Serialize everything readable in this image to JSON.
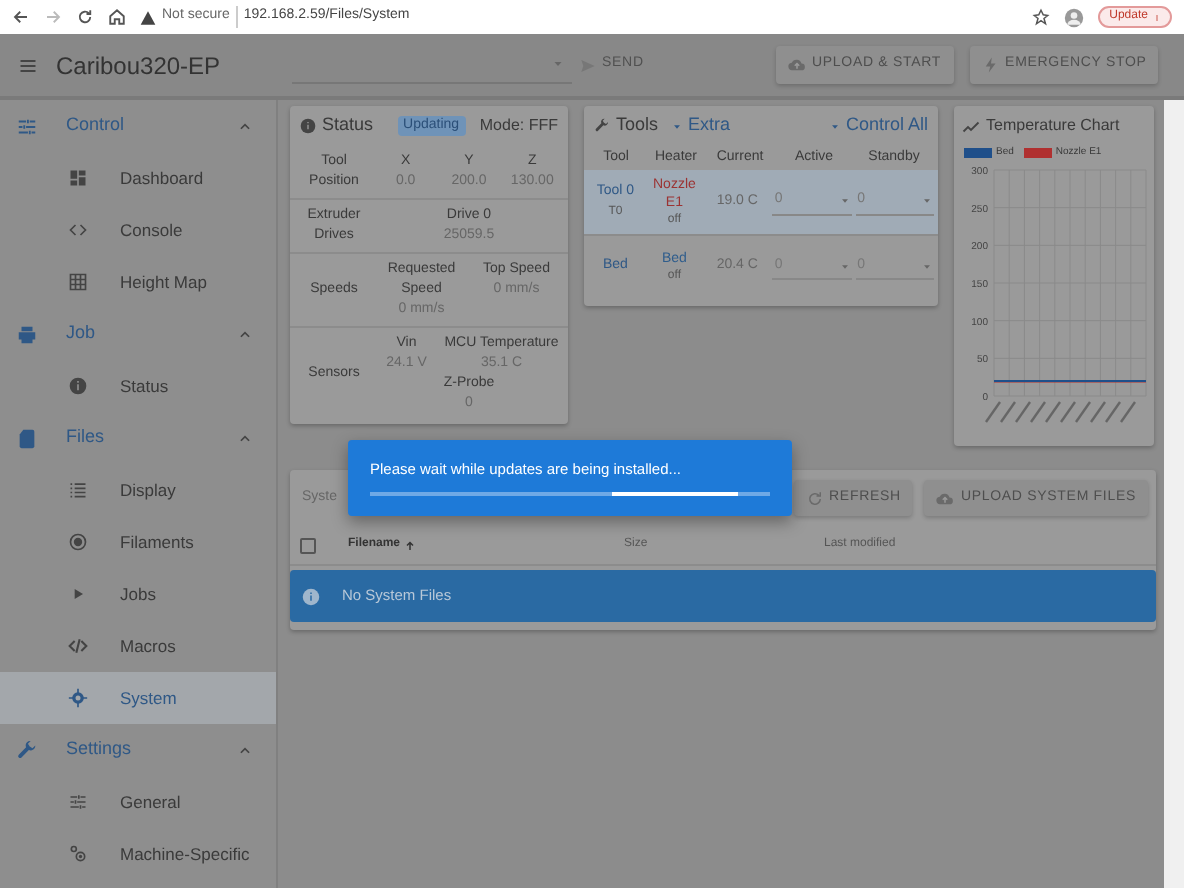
{
  "browser": {
    "security": "Not secure",
    "url": "192.168.2.59/Files/System",
    "update_button": "Update"
  },
  "app_bar": {
    "title": "Caribou320-EP",
    "send_button": "SEND",
    "buttons": [
      {
        "label": "UPLOAD & START"
      },
      {
        "label": "EMERGENCY STOP"
      }
    ]
  },
  "sidebar": {
    "groups": [
      {
        "label": "Control",
        "expanded": true,
        "items": [
          {
            "label": "Dashboard",
            "selected": false
          },
          {
            "label": "Console",
            "selected": false
          },
          {
            "label": "Height Map",
            "selected": false
          }
        ]
      },
      {
        "label": "Job",
        "expanded": true,
        "items": [
          {
            "label": "Status",
            "selected": false
          }
        ]
      },
      {
        "label": "Files",
        "expanded": true,
        "items": [
          {
            "label": "Display",
            "selected": false
          },
          {
            "label": "Filaments",
            "selected": false
          },
          {
            "label": "Jobs",
            "selected": false
          },
          {
            "label": "Macros",
            "selected": false
          },
          {
            "label": "System",
            "selected": true
          }
        ]
      },
      {
        "label": "Settings",
        "expanded": true,
        "items": [
          {
            "label": "General",
            "selected": false
          },
          {
            "label": "Machine-Specific",
            "selected": false
          }
        ]
      }
    ]
  },
  "status": {
    "title": "Status",
    "badge": "Updating",
    "mode": "Mode: FFF",
    "sections": [
      {
        "label": "Tool Position",
        "readings": [
          {
            "head": "X",
            "value": "0.0"
          },
          {
            "head": "Y",
            "value": "200.0"
          },
          {
            "head": "Z",
            "value": "130.00"
          }
        ]
      },
      {
        "label": "Extruder Drives",
        "readings": [
          {
            "head": "Drive 0",
            "value": "25059.5"
          }
        ]
      },
      {
        "label": "Speeds",
        "readings": [
          {
            "head": "Requested Speed",
            "value": "0 mm/s"
          },
          {
            "head": "Top Speed",
            "value": "0 mm/s"
          }
        ]
      },
      {
        "label": "Sensors",
        "readings": [
          {
            "head": "Vin",
            "value": "24.1 V"
          },
          {
            "head": "MCU Temperature",
            "value": "35.1 C"
          },
          {
            "head": "Z-Probe",
            "value": "0"
          }
        ]
      }
    ]
  },
  "tools": {
    "title": "Tools",
    "extra": "Extra",
    "control_all": "Control All",
    "columns": [
      "Tool",
      "Heater",
      "Current",
      "Active",
      "Standby"
    ],
    "rows": [
      {
        "tool": "Tool 0",
        "tool_sub": "T0",
        "heater": "Nozzle E1",
        "color": "#9b3333",
        "heater_state": "off",
        "current": "19.0 C",
        "active": "0",
        "standby": "0",
        "selected": true
      },
      {
        "tool": "Bed",
        "heater": "Bed",
        "color": "#2f5d8c",
        "heater_state": "off",
        "current": "20.4 C",
        "active": "0",
        "standby": "0",
        "selected": false
      }
    ]
  },
  "temperature_chart": {
    "title": "Temperature Chart",
    "chart_data": {
      "type": "line",
      "grid": true,
      "ylim": [
        0,
        300
      ],
      "yticks": [
        0,
        50,
        100,
        150,
        200,
        250,
        300
      ],
      "series": [
        {
          "name": "Bed",
          "color": "#1f4f8a",
          "values": [
            20,
            20,
            20,
            20,
            20,
            20,
            20,
            20,
            20,
            20
          ]
        },
        {
          "name": "Nozzle E1",
          "color": "#b03030",
          "values": [
            19,
            19,
            19,
            19,
            19,
            19,
            19,
            19,
            19,
            19
          ]
        }
      ]
    }
  },
  "files": {
    "breadcrumb": "Syste",
    "buttons": [
      {
        "label": "REFRESH"
      },
      {
        "label": "UPLOAD SYSTEM FILES"
      }
    ],
    "select_all_checked": false,
    "columns": [
      {
        "label": "Filename",
        "sorted": true
      },
      {
        "label": "Size",
        "sorted": false
      },
      {
        "label": "Last modified",
        "sorted": false
      }
    ],
    "empty_message": "No System Files"
  },
  "dialog": {
    "message": "Please wait while updates are being installed...",
    "indeterminate": true
  }
}
